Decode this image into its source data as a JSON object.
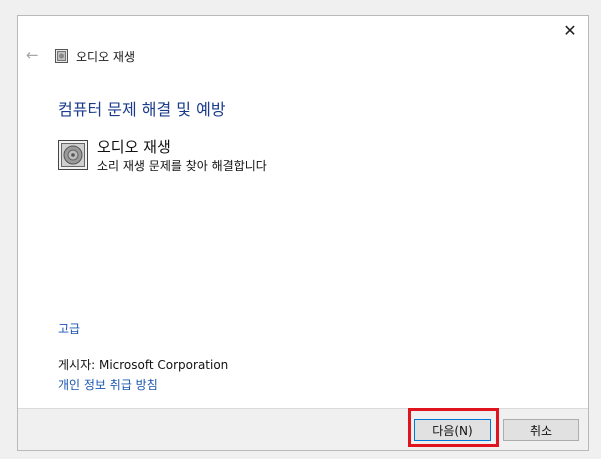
{
  "window": {
    "title": "오디오 재생",
    "close_label": "✕",
    "back_label": "←"
  },
  "content": {
    "heading": "컴퓨터 문제 해결 및 예방",
    "item_title": "오디오 재생",
    "item_description": "소리 재생 문제를 찾아 해결합니다",
    "advanced_link": "고급",
    "publisher": "게시자: Microsoft Corporation",
    "privacy_link": "개인 정보 취급 방침"
  },
  "footer": {
    "next_label": "다음(N)",
    "cancel_label": "취소"
  },
  "colors": {
    "heading": "#1a3c8c",
    "link": "#1a55b0",
    "highlight": "#e0141e"
  }
}
